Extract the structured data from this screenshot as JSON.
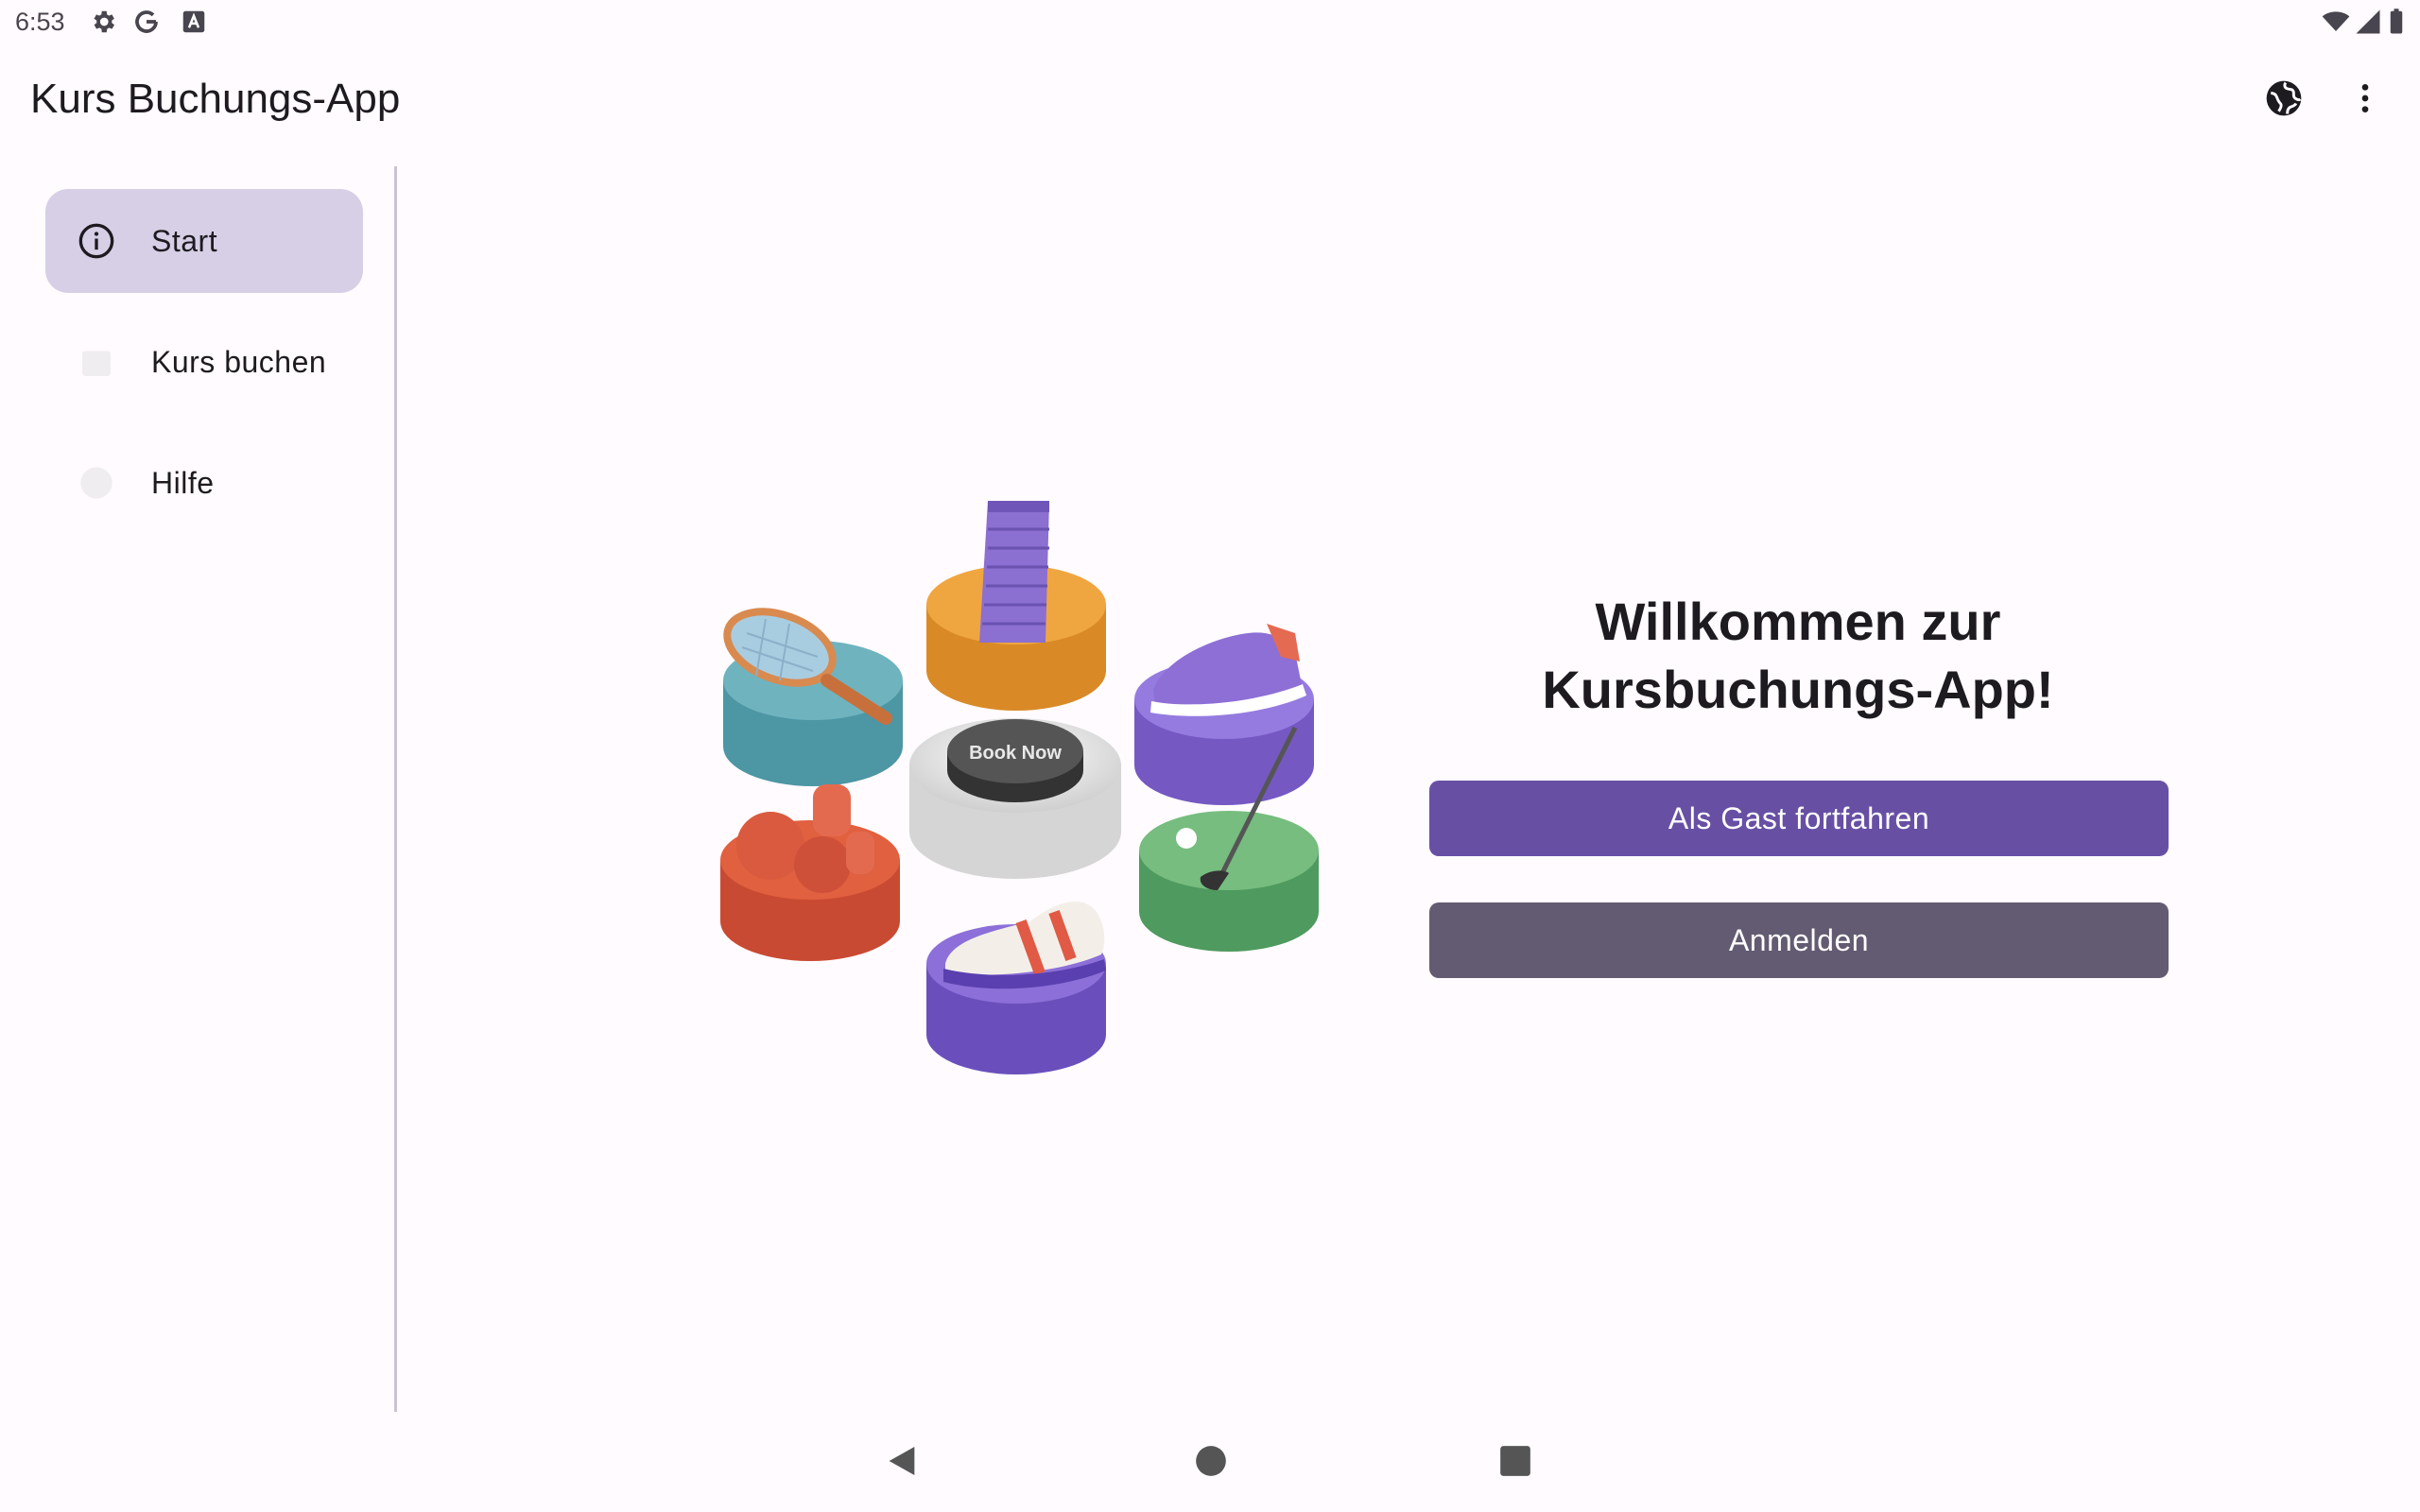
{
  "status_bar": {
    "time": "6:53",
    "icons_left": [
      "settings-icon",
      "google-icon",
      "app-notification-icon"
    ],
    "icons_right": [
      "wifi-icon",
      "signal-icon",
      "battery-icon"
    ]
  },
  "app_bar": {
    "title": "Kurs Buchungs-App",
    "actions": [
      "globe-icon",
      "more-vert-icon"
    ]
  },
  "drawer": {
    "items": [
      {
        "label": "Start",
        "icon": "info-icon",
        "active": true
      },
      {
        "label": "Kurs buchen",
        "icon": "calendar-icon",
        "active": false
      },
      {
        "label": "Hilfe",
        "icon": "help-icon",
        "active": false
      }
    ]
  },
  "hero": {
    "badge_text": "Book Now"
  },
  "welcome": {
    "title_line1": "Willkommen zur",
    "title_line2": "Kursbuchungs-App!"
  },
  "buttons": {
    "guest": "Als Gast fortfahren",
    "login": "Anmelden"
  },
  "colors": {
    "primary": "#6750a4",
    "secondary": "#625b71",
    "nav_active": "#d7cfe6",
    "background": "#fffbfe"
  }
}
